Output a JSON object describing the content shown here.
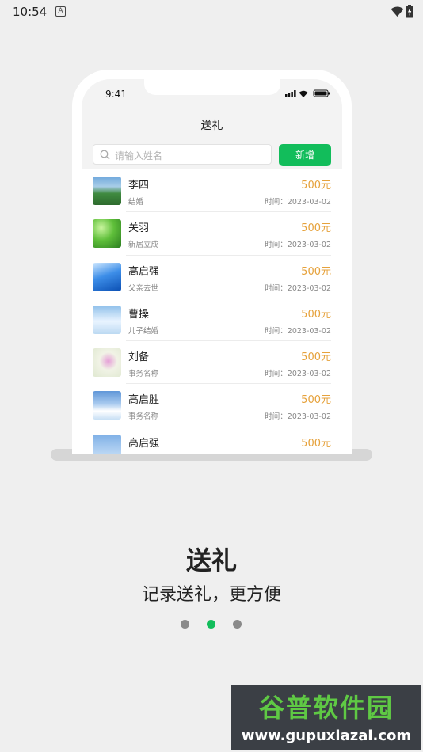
{
  "status_bar": {
    "time": "10:54",
    "notification_icon": "A"
  },
  "mockup": {
    "ios_time": "9:41",
    "title": "送礼",
    "search_placeholder": "请输入姓名",
    "add_button": "新增",
    "records": [
      {
        "name": "李四",
        "event": "结婚",
        "amount": "500元",
        "date": "时间：2023-03-02",
        "thumb": "landscape-image"
      },
      {
        "name": "关羽",
        "event": "新居立成",
        "amount": "500元",
        "date": "时间：2023-03-02",
        "thumb": "leaves-image"
      },
      {
        "name": "高启强",
        "event": "父亲去世",
        "amount": "500元",
        "date": "时间：2023-03-02",
        "thumb": "wave-image"
      },
      {
        "name": "曹操",
        "event": "儿子结婚",
        "amount": "500元",
        "date": "时间：2023-03-02",
        "thumb": "frost-image"
      },
      {
        "name": "刘备",
        "event": "事务名称",
        "amount": "500元",
        "date": "时间：2023-03-02",
        "thumb": "flower-image"
      },
      {
        "name": "高启胜",
        "event": "事务名称",
        "amount": "500元",
        "date": "时间：2023-03-02",
        "thumb": "clouds-image"
      },
      {
        "name": "高启强",
        "event": "",
        "amount": "500元",
        "date": "",
        "thumb": "sky-image"
      }
    ]
  },
  "intro": {
    "title": "送礼",
    "subtitle": "记录送礼，更方便",
    "page_count": 3,
    "active_page": 2,
    "active_color": "#12bd5b"
  },
  "watermark": {
    "line1": "谷普软件园",
    "line2": "www.gupuxlazal.com"
  }
}
